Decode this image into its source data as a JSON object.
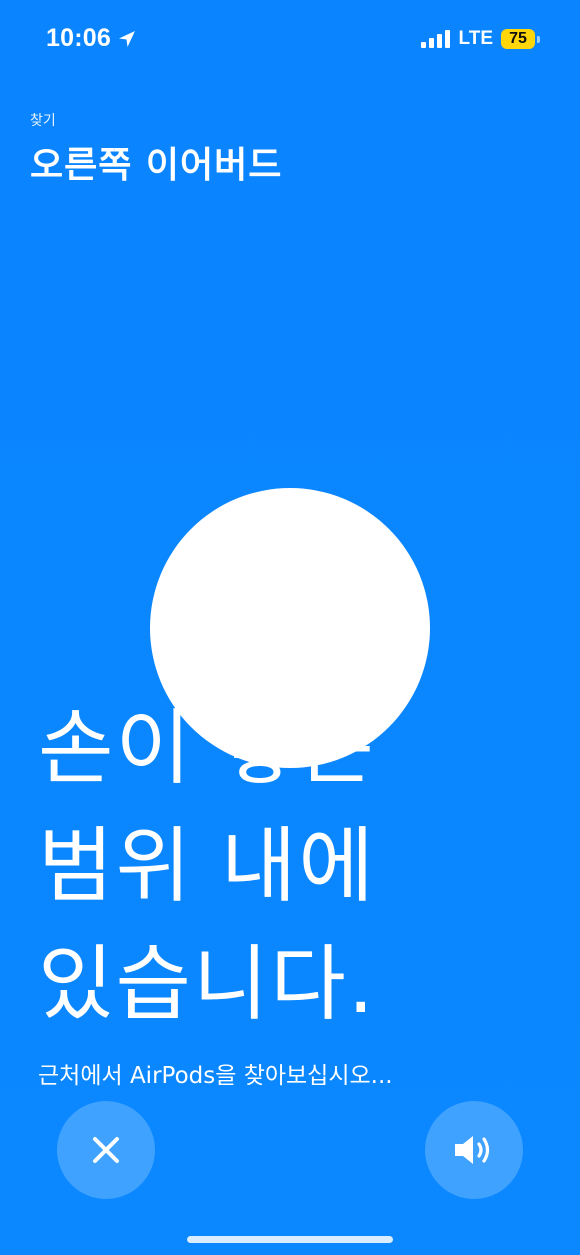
{
  "status_bar": {
    "time": "10:06",
    "network": "LTE",
    "battery_level": "75",
    "battery_color": "#ffd60a",
    "icons": [
      "location-arrow-icon",
      "signal-bars-icon",
      "battery-icon"
    ]
  },
  "header": {
    "breadcrumb": "찾기",
    "title": "오른쪽 이어버드"
  },
  "status": {
    "lines": [
      "손이 닿는",
      "범위 내에",
      "있습니다."
    ],
    "subtitle": "근처에서 AirPods을 찾아보십시오..."
  },
  "buttons": {
    "close_icon": "close-icon",
    "sound_icon": "speaker-icon"
  },
  "colors": {
    "background": "#0a84ff",
    "foreground": "#ffffff"
  }
}
